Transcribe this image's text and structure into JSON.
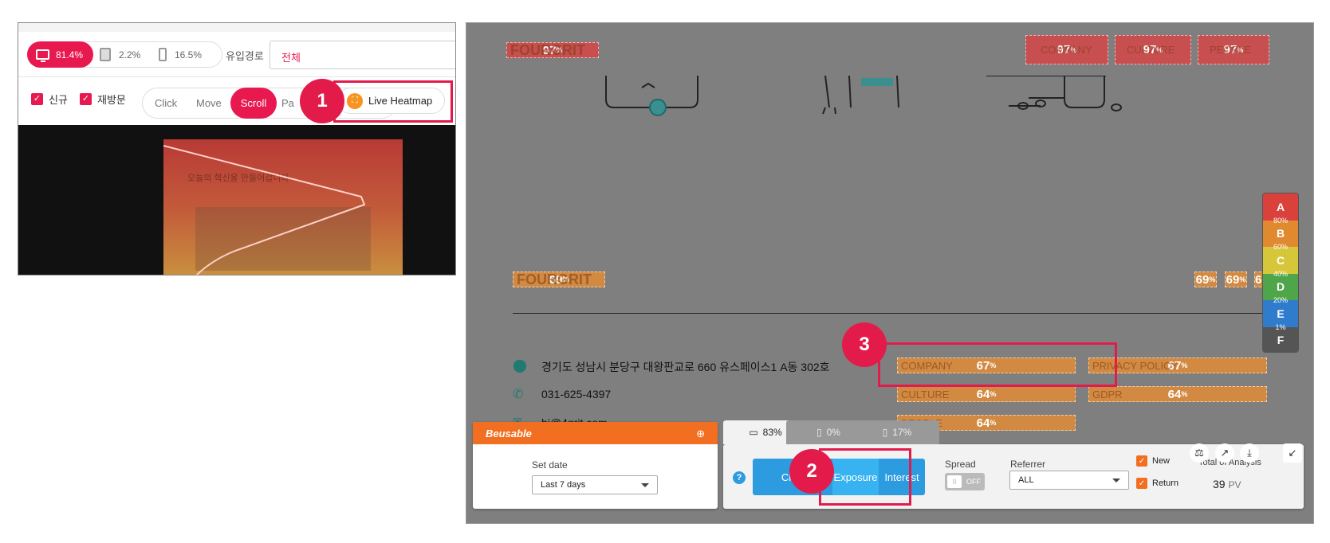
{
  "left_panel": {
    "devices": [
      {
        "label": "81.4%"
      },
      {
        "label": "2.2%"
      },
      {
        "label": "16.5%"
      }
    ],
    "traffic_label": "유입경로",
    "traffic_value": "전체",
    "filters": [
      {
        "label": "신규"
      },
      {
        "label": "재방문"
      }
    ],
    "modes": [
      "Click",
      "Move",
      "Scroll",
      "Pa"
    ],
    "live_btn": "Live Heatmap",
    "preview_title": "오늘의 혁신을 만들어갑니다"
  },
  "markers": [
    "1",
    "2",
    "3"
  ],
  "right_panel": {
    "top_blocks": [
      {
        "ghost": "FOURGRIT",
        "value": "97",
        "unit": "%"
      },
      {
        "ghost": "COMPANY",
        "value": "97",
        "unit": "%"
      },
      {
        "ghost": "CULTURE",
        "value": "97",
        "unit": "%"
      },
      {
        "ghost": "PEOPLE",
        "value": "97",
        "unit": "%"
      }
    ],
    "mid_blocks": [
      {
        "ghost": "FOURGRIT",
        "value": "69",
        "unit": "%"
      },
      {
        "value": "69",
        "unit": "%"
      },
      {
        "value": "69",
        "unit": "%"
      },
      {
        "value": "6",
        "unit": ""
      }
    ],
    "footer_blocks": [
      {
        "ghost": "COMPANY",
        "value": "67",
        "unit": "%"
      },
      {
        "ghost": "PRIVACY POLICY",
        "value": "67",
        "unit": "%"
      },
      {
        "ghost": "CULTURE",
        "value": "64",
        "unit": "%"
      },
      {
        "ghost": "GDPR",
        "value": "64",
        "unit": "%"
      },
      {
        "ghost": "PEOPLE",
        "value": "64",
        "unit": "%"
      }
    ],
    "address": "경기도 성남시 분당구 대왕판교로 660 유스페이스1 A동 302호",
    "phone": "031-625-4397",
    "email_partial": "hi@4grit.com",
    "legend": [
      {
        "grade": "A",
        "color": "#d9413a",
        "pct": "80%"
      },
      {
        "grade": "B",
        "color": "#e0892e",
        "pct": "60%"
      },
      {
        "grade": "C",
        "color": "#d6c63a",
        "pct": "40%"
      },
      {
        "grade": "D",
        "color": "#4fa64a",
        "pct": "20%"
      },
      {
        "grade": "E",
        "color": "#2f7ccc",
        "pct": "1%"
      },
      {
        "grade": "F",
        "color": "#555555",
        "pct": ""
      }
    ]
  },
  "toolbar": {
    "brand": "Beusable",
    "set_date_label": "Set date",
    "set_date_value": "Last 7 days",
    "tabs": [
      {
        "label": "83%"
      },
      {
        "label": "0%"
      },
      {
        "label": "17%"
      }
    ],
    "help": "?",
    "modes": [
      "Click",
      "Exposure",
      "Interest"
    ],
    "spread_label": "Spread",
    "spread_toggle": "OFF",
    "referrer_label": "Referrer",
    "referrer_value": "ALL",
    "new_label": "New",
    "return_label": "Return",
    "total_label": "Total of Analysis",
    "total_value": "39",
    "total_unit": "PV"
  },
  "colors": {
    "accent": "#e8194f",
    "orange": "#f26f21",
    "blue": "#2c9be0"
  }
}
